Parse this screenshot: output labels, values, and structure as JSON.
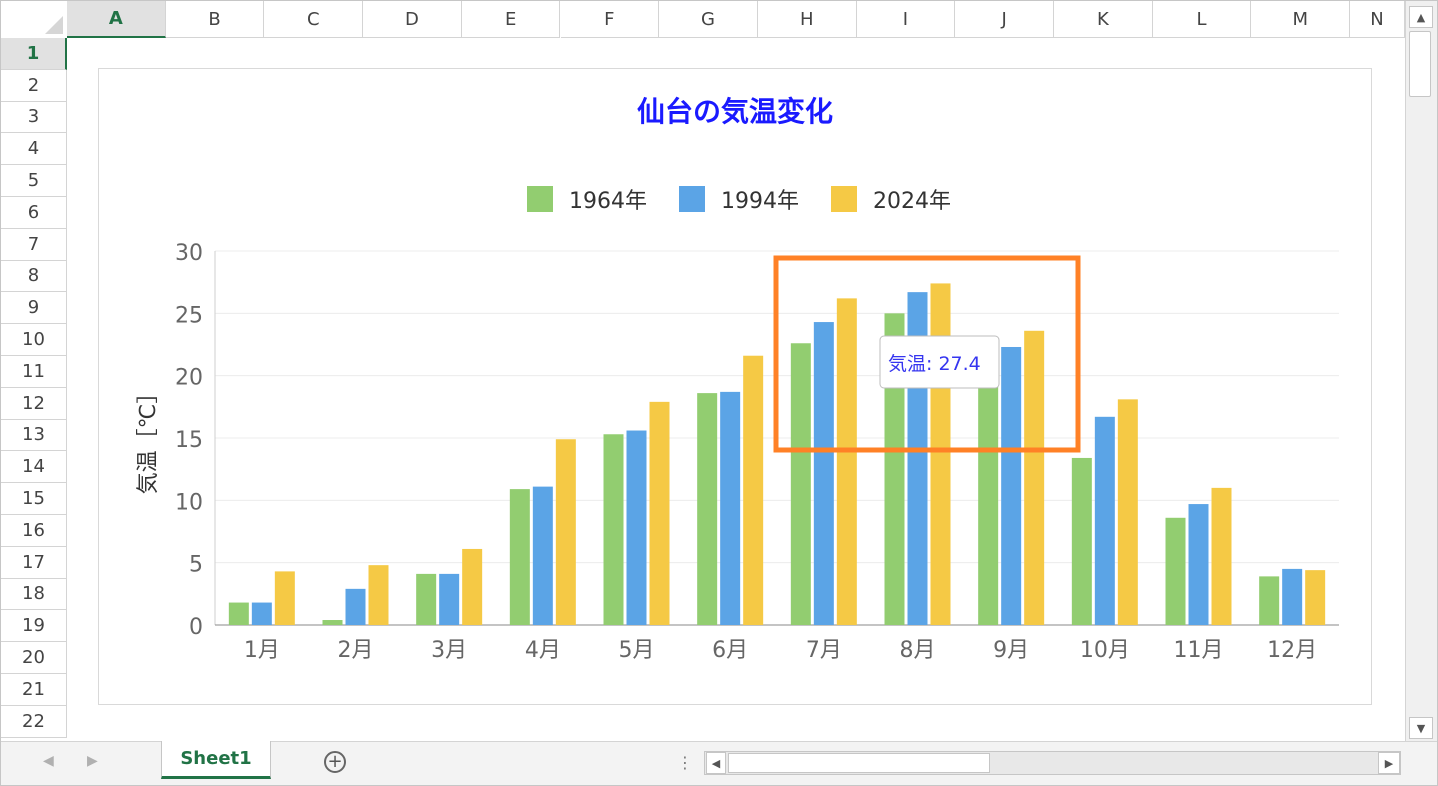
{
  "sheet": {
    "columns": [
      "A",
      "B",
      "C",
      "D",
      "E",
      "F",
      "G",
      "H",
      "I",
      "J",
      "K",
      "L",
      "M",
      "N"
    ],
    "selected_column": "A",
    "rows": [
      "1",
      "2",
      "3",
      "4",
      "5",
      "6",
      "7",
      "8",
      "9",
      "10",
      "11",
      "12",
      "13",
      "14",
      "15",
      "16",
      "17",
      "18",
      "19",
      "20",
      "21",
      "22"
    ],
    "selected_row": "1"
  },
  "tabs": {
    "active": "Sheet1"
  },
  "tooltip": {
    "text": "気温: 27.4"
  },
  "colors": {
    "series": [
      "#92cd70",
      "#5ba4e6",
      "#f5c945"
    ],
    "title": "#1a1aff",
    "highlight_box": "#ff8126",
    "tooltip_text": "#3535f0",
    "tab_active": "#217346"
  },
  "icons": {
    "scroll_up": "▲",
    "scroll_down": "▼",
    "scroll_left": "◀",
    "scroll_right": "▶",
    "nav_prev": "◀",
    "nav_next": "▶",
    "add_sheet": "+",
    "splitter": "⋮"
  },
  "chart_data": {
    "type": "bar",
    "title": "仙台の気温変化",
    "ylabel": "気温［℃］",
    "xlabel": "",
    "ylim": [
      0,
      30
    ],
    "yticks": [
      0,
      5,
      10,
      15,
      20,
      25,
      30
    ],
    "grid": true,
    "legend_position": "top",
    "categories": [
      "1月",
      "2月",
      "3月",
      "4月",
      "5月",
      "6月",
      "7月",
      "8月",
      "9月",
      "10月",
      "11月",
      "12月"
    ],
    "series": [
      {
        "name": "1964年",
        "values": [
          1.8,
          0.4,
          4.1,
          10.9,
          15.3,
          18.6,
          22.6,
          25.0,
          21.0,
          13.4,
          8.6,
          3.9
        ]
      },
      {
        "name": "1994年",
        "values": [
          1.8,
          2.9,
          4.1,
          11.1,
          15.6,
          18.7,
          24.3,
          26.7,
          22.3,
          16.7,
          9.7,
          4.5
        ]
      },
      {
        "name": "2024年",
        "values": [
          4.3,
          4.8,
          6.1,
          14.9,
          17.9,
          21.6,
          26.2,
          27.4,
          23.6,
          18.1,
          11.0,
          4.4
        ]
      }
    ]
  }
}
